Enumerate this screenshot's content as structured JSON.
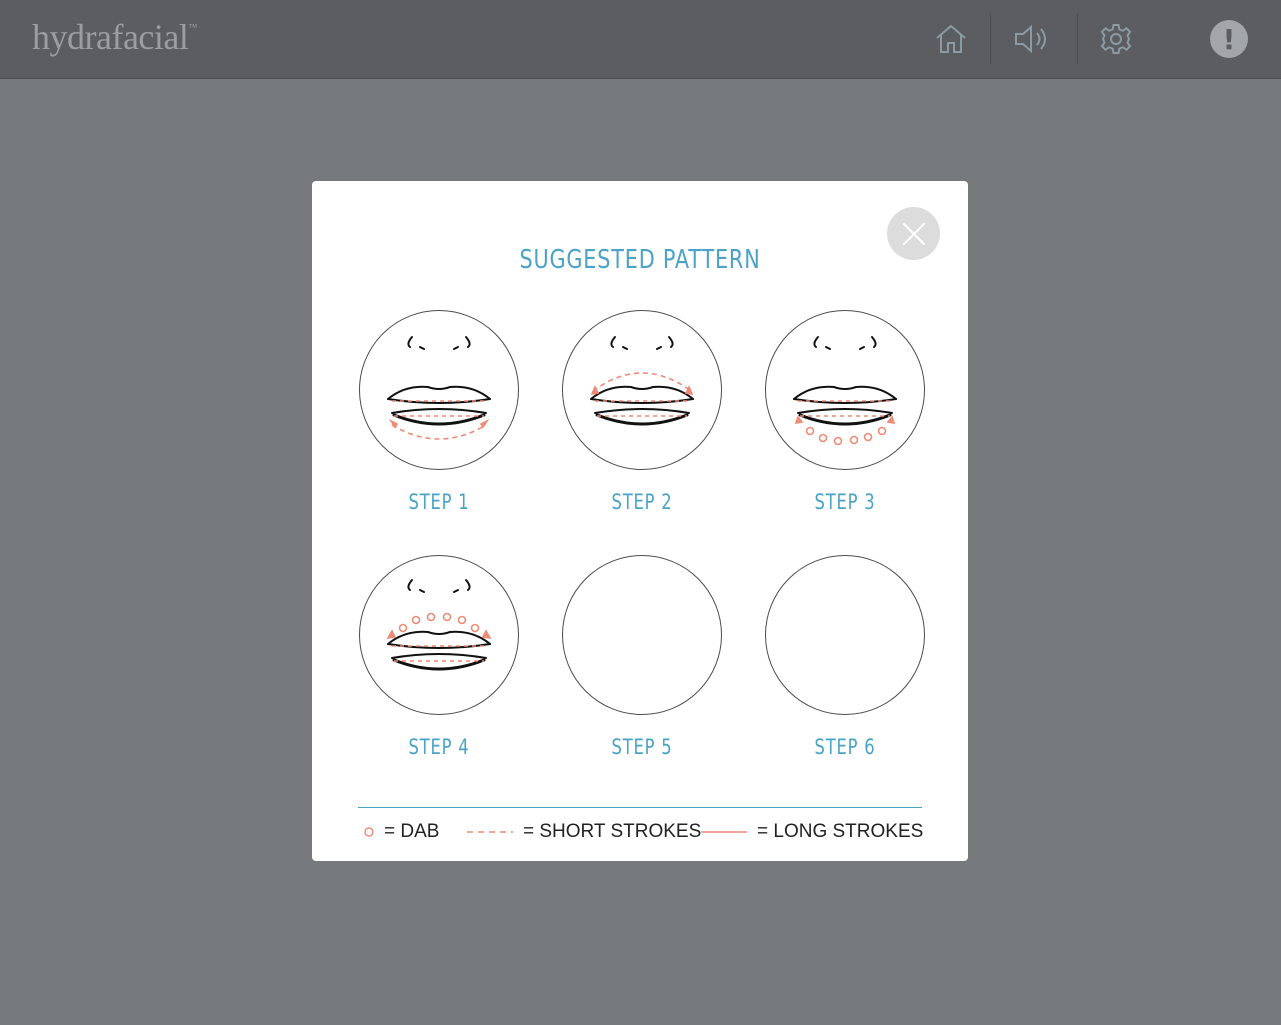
{
  "app": {
    "logo_text": "hydrafacial",
    "logo_mark": "™"
  },
  "toolbar": {
    "icons": [
      "home-icon",
      "speaker-icon",
      "settings-gear-icon",
      "alert-icon"
    ],
    "alert_glyph": "!"
  },
  "modal": {
    "title": "SUGGESTED PATTERN",
    "steps": [
      {
        "label": "STEP 1"
      },
      {
        "label": "STEP 2"
      },
      {
        "label": "STEP 3"
      },
      {
        "label": "STEP 4"
      },
      {
        "label": "STEP 5"
      },
      {
        "label": "STEP 6"
      }
    ],
    "legend": {
      "dab": "= DAB",
      "short": "= SHORT STROKES",
      "long": "= LONG STROKES"
    }
  },
  "colors": {
    "background": "#76797c",
    "topbar": "#5b5d61",
    "accent": "#4aa3c7",
    "stroke_marks": "#ef8a77"
  }
}
